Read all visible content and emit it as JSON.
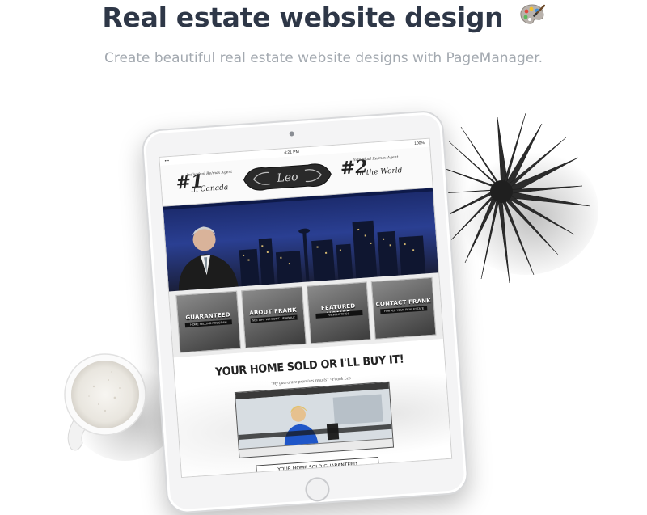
{
  "page": {
    "title": "Real estate website design",
    "subtitle": "Create beautiful real estate website designs with PageManager.",
    "title_icon": "artist-palette-icon"
  },
  "tablet": {
    "status": {
      "time": "4:21 PM",
      "battery": "100%"
    },
    "header": {
      "badge1": {
        "number": "#1",
        "text": "Individual Re/max Agent",
        "place": "in Canada"
      },
      "badge2": {
        "number": "#2",
        "text": "Individual Re/max Agent",
        "place": "in the World"
      }
    },
    "tiles": [
      {
        "label": "GUARANTEED",
        "sub": "HOME SELLING PROGRAM"
      },
      {
        "label": "ABOUT FRANK",
        "sub": "SEE WHY WE DON'T LIE ABOUT"
      },
      {
        "label": "FEATURED HOMES",
        "sub": "VIEW LISTINGS"
      },
      {
        "label": "CONTACT FRANK",
        "sub": "FOR ALL YOUR REAL ESTATE"
      }
    ],
    "headline": "YOUR HOME SOLD OR I'LL BUY IT!",
    "quote": "\"My guarantee promises results\" ~Frank Leo",
    "cta": "YOUR HOME SOLD GUARANTEED"
  },
  "colors": {
    "title": "#2e3747",
    "subtitle": "#a3a9b0",
    "hero_sky": "#2a3f92"
  }
}
